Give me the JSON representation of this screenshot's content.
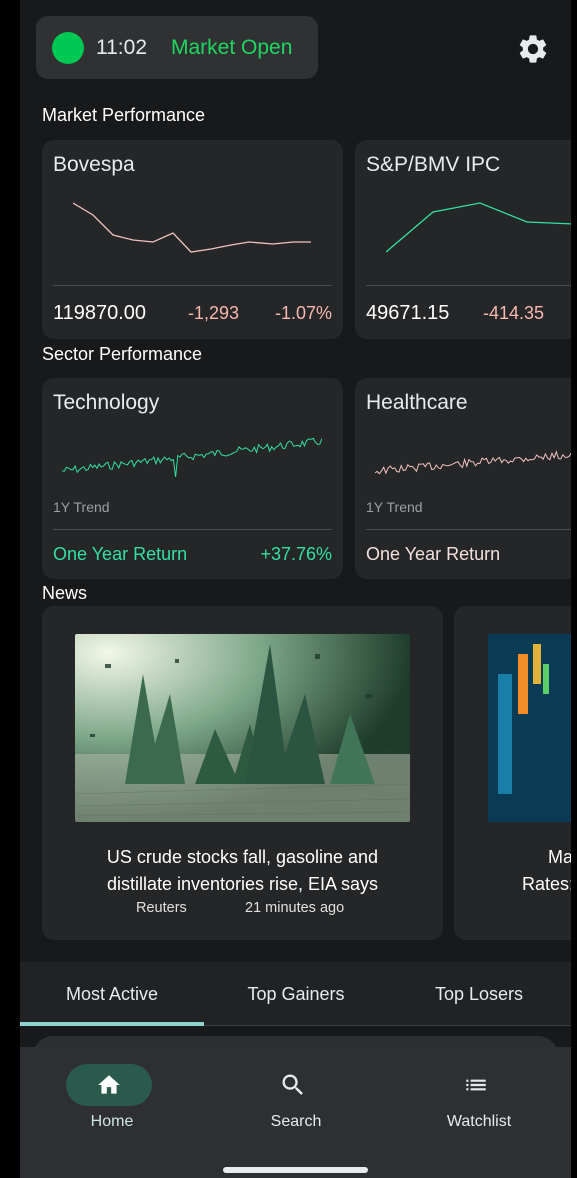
{
  "status": {
    "time": "11:02",
    "market_state": "Market Open"
  },
  "sections": {
    "market": "Market Performance",
    "sector": "Sector Performance",
    "news": "News"
  },
  "markets": [
    {
      "name": "Bovespa",
      "value": "119870.00",
      "change": "-1,293",
      "percent": "-1.07%",
      "trend_color": "#f4c2bd"
    },
    {
      "name": "S&P/BMV IPC",
      "value": "49671.15",
      "change": "-414.35",
      "percent": "",
      "trend_color": "#33e0a1"
    }
  ],
  "sectors": [
    {
      "name": "Technology",
      "trend_label": "1Y Trend",
      "return_label": "One Year Return",
      "return_value": "+37.76%",
      "color": "#33e0a1"
    },
    {
      "name": "Healthcare",
      "trend_label": "1Y Trend",
      "return_label": "One Year Return",
      "return_value": "",
      "color": "#f4c2bd"
    }
  ],
  "news": [
    {
      "headline_line1": "US crude stocks fall, gasoline and",
      "headline_line2": "distillate inventories rise, EIA says",
      "source": "Reuters",
      "time": "21 minutes ago"
    },
    {
      "headline_line1": "Mar",
      "headline_line2": "Rates:",
      "source": "",
      "time": ""
    }
  ],
  "tabs": [
    "Most Active",
    "Top Gainers",
    "Top Losers"
  ],
  "nav": [
    {
      "label": "Home",
      "icon": "home-icon",
      "active": true
    },
    {
      "label": "Search",
      "icon": "search-icon",
      "active": false
    },
    {
      "label": "Watchlist",
      "icon": "watchlist-icon",
      "active": false
    }
  ],
  "colors": {
    "accent": "#1ed760",
    "positive": "#33e0a1",
    "negative": "#f7b8ae",
    "nav_active": "#2a5a4b"
  }
}
